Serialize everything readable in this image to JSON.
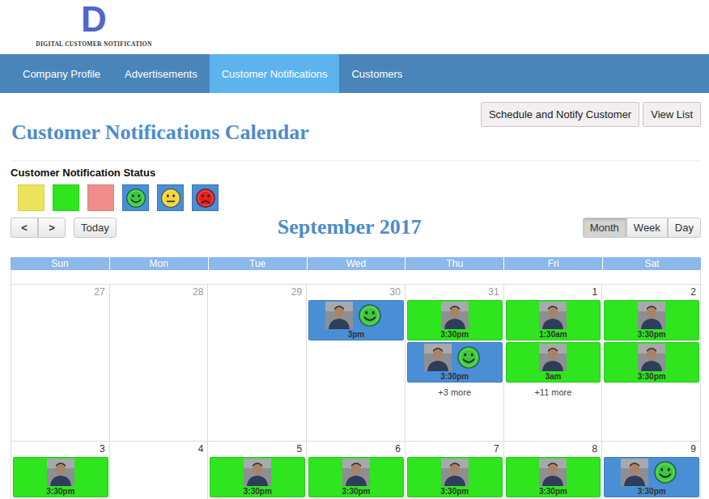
{
  "logo": {
    "mark": "D",
    "name": "DIGITAL CUSTOMER NOTIFICATION"
  },
  "nav": [
    {
      "label": "Company Profile",
      "selected": false
    },
    {
      "label": "Advertisements",
      "selected": false
    },
    {
      "label": "Customer Notifications",
      "selected": true
    },
    {
      "label": "Customers",
      "selected": false
    }
  ],
  "actions": [
    "Schedule and Notify Customer",
    "View List"
  ],
  "title": "Customer Notifications Calendar",
  "legend": {
    "title": "Customer Notification Status",
    "items": [
      {
        "kind": "swatch",
        "color": "#ebe45a"
      },
      {
        "kind": "swatch",
        "color": "#2ee51e"
      },
      {
        "kind": "swatch",
        "color": "#f08e8c"
      },
      {
        "kind": "happy",
        "color": "#3cc83c"
      },
      {
        "kind": "neutral",
        "color": "#f2d43a"
      },
      {
        "kind": "sad",
        "color": "#e02020"
      }
    ]
  },
  "calendar": {
    "nav": [
      "<",
      ">"
    ],
    "today": "Today",
    "month": "September 2017",
    "views": [
      {
        "label": "Month",
        "selected": true
      },
      {
        "label": "Week",
        "selected": false
      },
      {
        "label": "Day",
        "selected": false
      }
    ],
    "weekdays": [
      "Sun",
      "Mon",
      "Tue",
      "Wed",
      "Thu",
      "Fri",
      "Sat"
    ],
    "weeks": [
      {
        "days": [
          {
            "day": "27",
            "other_month": true,
            "events": [],
            "more": ""
          },
          {
            "day": "28",
            "other_month": true,
            "events": [],
            "more": ""
          },
          {
            "day": "29",
            "other_month": true,
            "events": [],
            "more": ""
          },
          {
            "day": "30",
            "other_month": true,
            "events": [
              {
                "time": "3pm",
                "kind": "happy",
                "color": "#4a8fd6"
              }
            ],
            "more": ""
          },
          {
            "day": "31",
            "other_month": true,
            "events": [
              {
                "time": "3:30pm",
                "kind": "plain",
                "color": "#2ee51e"
              },
              {
                "time": "3:30pm",
                "kind": "happy",
                "color": "#4a8fd6"
              }
            ],
            "more": "+3 more"
          },
          {
            "day": "1",
            "other_month": false,
            "events": [
              {
                "time": "1:30am",
                "kind": "plain",
                "color": "#2ee51e"
              },
              {
                "time": "3am",
                "kind": "plain",
                "color": "#2ee51e"
              }
            ],
            "more": "+11 more"
          },
          {
            "day": "2",
            "other_month": false,
            "events": [
              {
                "time": "3:30pm",
                "kind": "plain",
                "color": "#2ee51e"
              },
              {
                "time": "3:30pm",
                "kind": "plain",
                "color": "#2ee51e"
              }
            ],
            "more": ""
          }
        ]
      },
      {
        "days": [
          {
            "day": "3",
            "other_month": false,
            "events": [
              {
                "time": "3:30pm",
                "kind": "plain",
                "color": "#2ee51e"
              }
            ],
            "more": ""
          },
          {
            "day": "4",
            "other_month": false,
            "events": [],
            "more": ""
          },
          {
            "day": "5",
            "other_month": false,
            "events": [
              {
                "time": "3:30pm",
                "kind": "plain",
                "color": "#2ee51e"
              }
            ],
            "more": ""
          },
          {
            "day": "6",
            "other_month": false,
            "events": [
              {
                "time": "3:30pm",
                "kind": "plain",
                "color": "#2ee51e"
              }
            ],
            "more": ""
          },
          {
            "day": "7",
            "other_month": false,
            "events": [
              {
                "time": "3:30pm",
                "kind": "plain",
                "color": "#2ee51e"
              }
            ],
            "more": ""
          },
          {
            "day": "8",
            "other_month": false,
            "events": [
              {
                "time": "3:30pm",
                "kind": "plain",
                "color": "#2ee51e"
              }
            ],
            "more": ""
          },
          {
            "day": "9",
            "other_month": false,
            "events": [
              {
                "time": "3:30pm",
                "kind": "happy",
                "color": "#4a8fd6"
              }
            ],
            "more": ""
          }
        ]
      }
    ]
  }
}
